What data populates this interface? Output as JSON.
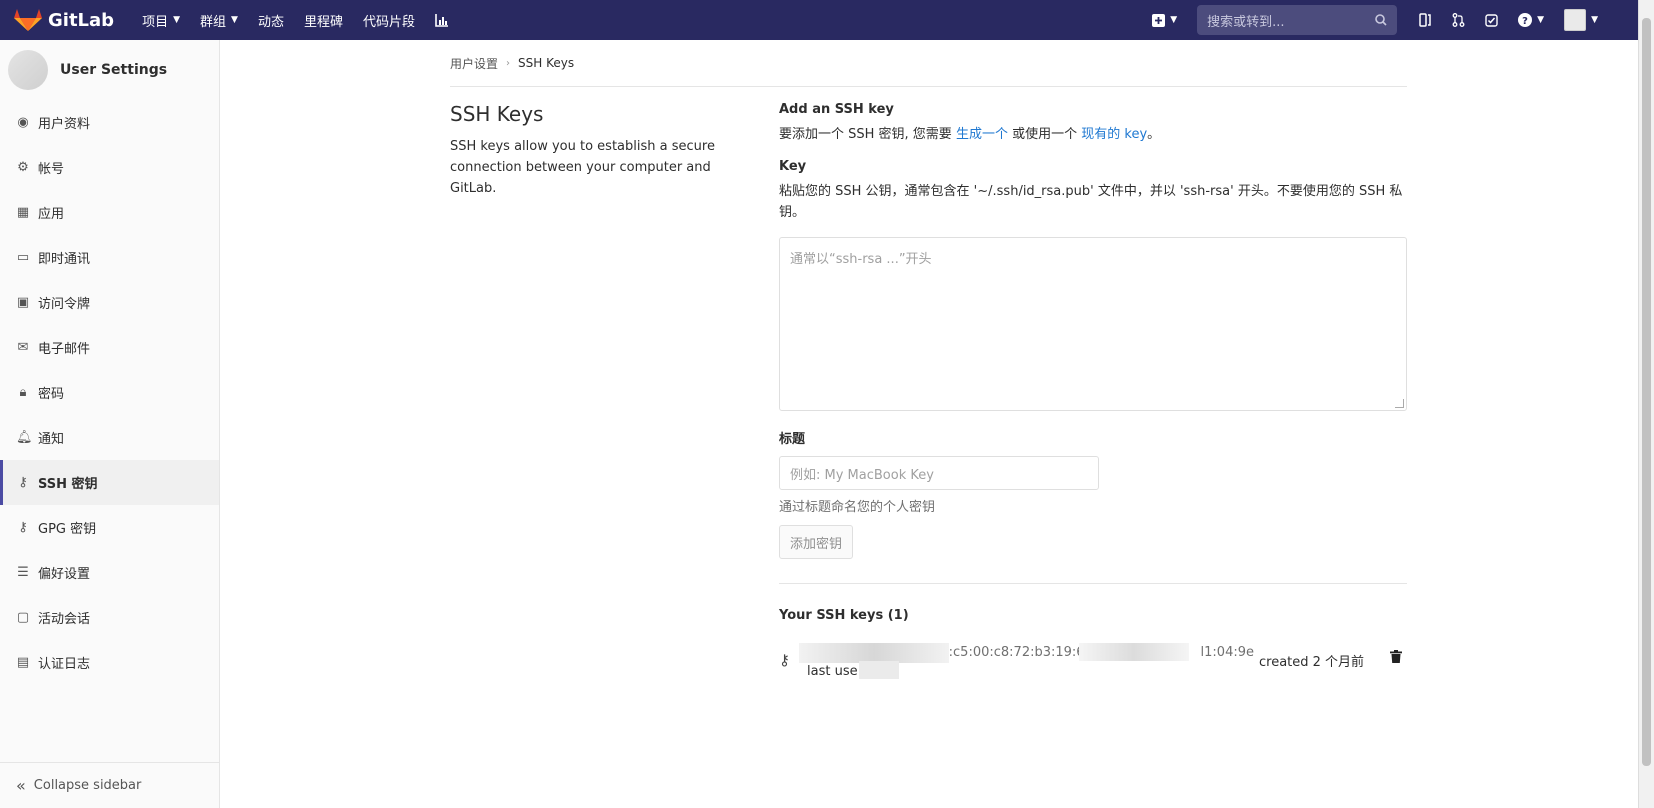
{
  "navbar": {
    "brand": "GitLab",
    "links": [
      {
        "label": "项目",
        "caret": true
      },
      {
        "label": "群组",
        "caret": true
      },
      {
        "label": "动态",
        "caret": false
      },
      {
        "label": "里程碑",
        "caret": false
      },
      {
        "label": "代码片段",
        "caret": false
      }
    ],
    "search_placeholder": "搜索或转到..."
  },
  "sidebar": {
    "title": "User Settings",
    "items": [
      {
        "label": "用户资料",
        "icon": "profile-icon"
      },
      {
        "label": "帐号",
        "icon": "account-icon"
      },
      {
        "label": "应用",
        "icon": "applications-icon"
      },
      {
        "label": "即时通讯",
        "icon": "chat-icon"
      },
      {
        "label": "访问令牌",
        "icon": "token-icon"
      },
      {
        "label": "电子邮件",
        "icon": "mail-icon"
      },
      {
        "label": "密码",
        "icon": "lock-icon"
      },
      {
        "label": "通知",
        "icon": "bell-icon"
      },
      {
        "label": "SSH 密钥",
        "icon": "key-icon",
        "active": true
      },
      {
        "label": "GPG 密钥",
        "icon": "key-icon"
      },
      {
        "label": "偏好设置",
        "icon": "preferences-icon"
      },
      {
        "label": "活动会话",
        "icon": "monitor-icon"
      },
      {
        "label": "认证日志",
        "icon": "log-icon"
      }
    ],
    "collapse": "Collapse sidebar"
  },
  "breadcrumb": {
    "parent": "用户设置",
    "current": "SSH Keys"
  },
  "intro": {
    "title": "SSH Keys",
    "description": "SSH keys allow you to establish a secure connection between your computer and GitLab."
  },
  "form": {
    "heading": "Add an SSH key",
    "prefix": "要添加一个 SSH 密钥, 您需要",
    "generate_link": "生成一个",
    "mid": "或使用一个",
    "existing_link": "现有的 key",
    "suffix": "。",
    "key_label": "Key",
    "key_help": "粘贴您的 SSH 公钥，通常包含在 '~/.ssh/id_rsa.pub' 文件中，并以 'ssh-rsa' 开头。不要使用您的 SSH 私钥。",
    "key_placeholder": "通常以“ssh-rsa ...”开头",
    "title_label": "标题",
    "title_placeholder": "例如: My MacBook Key",
    "title_help": "通过标题命名您的个人密钥",
    "submit": "添加密钥"
  },
  "keys": {
    "heading": "Your SSH keys (1)",
    "fingerprint": "m f2:c5:00:c8:72:b3:19:69:",
    "fingerprint_tail": "l1:04:9e",
    "last_used": "last use",
    "created": "created 2 个月前"
  }
}
